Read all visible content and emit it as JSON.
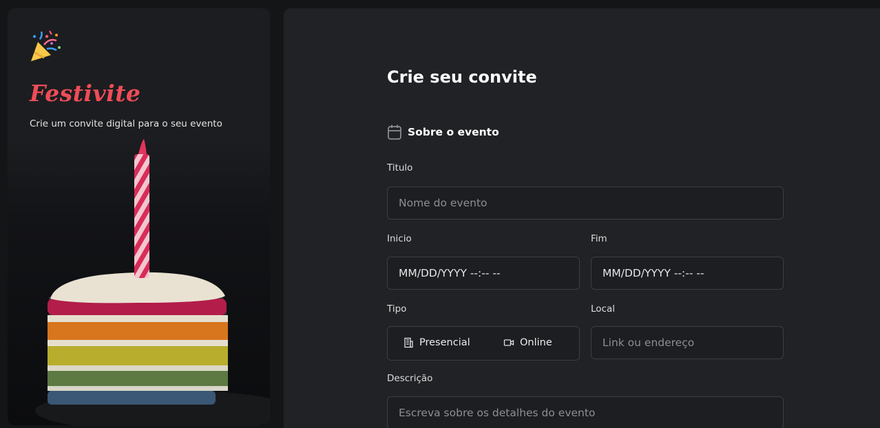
{
  "brand": {
    "name": "Festivite",
    "tagline": "Crie um convite digital para o seu evento",
    "logo_icon": "party-popper-icon"
  },
  "form": {
    "title": "Crie seu convite",
    "section": {
      "icon": "calendar-icon",
      "title": "Sobre o evento"
    },
    "titulo": {
      "label": "Titulo",
      "placeholder": "Nome do evento"
    },
    "inicio": {
      "label": "Inicio",
      "value": "MM/DD/YYYY --:-- --"
    },
    "fim": {
      "label": "Fim",
      "value": "MM/DD/YYYY --:-- --"
    },
    "tipo": {
      "label": "Tipo",
      "options": [
        {
          "label": "Presencial",
          "icon": "building-icon"
        },
        {
          "label": "Online",
          "icon": "video-camera-icon"
        }
      ]
    },
    "local": {
      "label": "Local",
      "placeholder": "Link ou endereço"
    },
    "descricao": {
      "label": "Descrição",
      "placeholder": "Escreva sobre os detalhes do evento"
    }
  },
  "colors": {
    "accent": "#ef4c58",
    "panel": "#202225",
    "sidebar": "#1c1d20"
  }
}
